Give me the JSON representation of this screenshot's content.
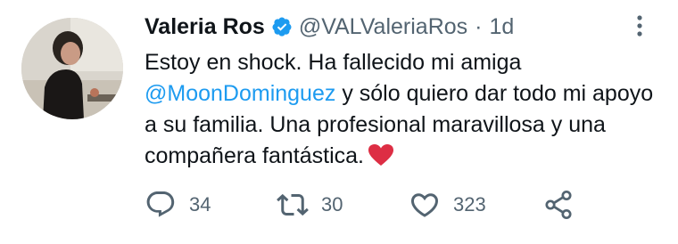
{
  "tweet": {
    "author_name": "Valeria Ros",
    "handle": "@VALValeriaRos",
    "separator": "·",
    "time": "1d",
    "text_before": "Estoy en shock. Ha fallecido mi amiga ",
    "mention": "@MoonDominguez",
    "text_after": " y sólo quiero dar todo mi apoyo a su familia. Una profesional maravillosa y una compañera fantástica.",
    "emoji": "red-heart-emoji"
  },
  "actions": {
    "replies": "34",
    "retweets": "30",
    "likes": "323"
  },
  "icons": {
    "verified": "verified-badge-icon",
    "more": "more-options-icon",
    "reply": "reply-icon",
    "retweet": "retweet-icon",
    "like": "like-icon",
    "share": "share-icon"
  },
  "colors": {
    "accent": "#1d9bf0",
    "text": "#0f1419",
    "secondary": "#536471",
    "emoji_heart": "#dd2e44"
  }
}
